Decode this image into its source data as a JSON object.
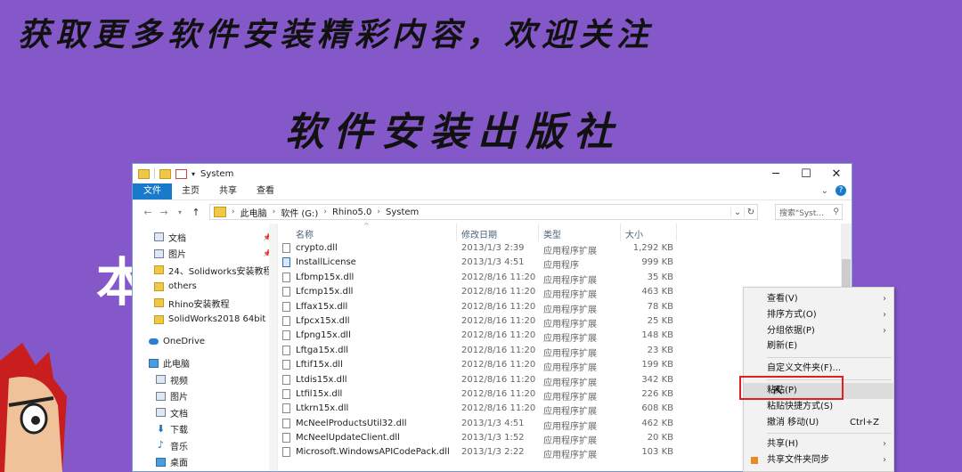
{
  "banner": {
    "top_text": "获取更多软件安装精彩内容，欢迎关注",
    "mid_text": "软件安装出版社",
    "left_char": "本"
  },
  "window": {
    "title": "System",
    "ctrl_min": "─",
    "ctrl_max": "☐",
    "ctrl_close": "✕",
    "tabs": [
      "文件",
      "主页",
      "共享",
      "查看"
    ],
    "address": {
      "crumbs": [
        "此电脑",
        "软件 (G:)",
        "Rhino5.0",
        "System"
      ],
      "search_placeholder": "搜索\"Syst..."
    }
  },
  "nav_pane": {
    "quick_access": [
      {
        "label": "文档",
        "icon": "doc-icon",
        "pinned": true
      },
      {
        "label": "图片",
        "icon": "picture-icon",
        "pinned": true
      },
      {
        "label": "24、Solidworks安装教程",
        "icon": "folder-icon",
        "pinned": false
      },
      {
        "label": "others",
        "icon": "folder-icon",
        "pinned": false
      },
      {
        "label": "Rhino安装教程",
        "icon": "folder-icon",
        "pinned": false
      },
      {
        "label": "SolidWorks2018 64bit",
        "icon": "folder-icon",
        "pinned": false
      }
    ],
    "onedrive": "OneDrive",
    "this_pc": "此电脑",
    "pc_items": [
      {
        "label": "视频",
        "icon": "video-icon"
      },
      {
        "label": "图片",
        "icon": "picture-icon"
      },
      {
        "label": "文档",
        "icon": "doc-icon"
      },
      {
        "label": "下载",
        "icon": "download-icon"
      },
      {
        "label": "音乐",
        "icon": "music-icon"
      },
      {
        "label": "桌面",
        "icon": "desktop-icon"
      }
    ]
  },
  "file_list": {
    "columns": {
      "name": "名称",
      "date": "修改日期",
      "type": "类型",
      "size": "大小"
    },
    "rows": [
      {
        "name": "crypto.dll",
        "date": "2013/1/3 2:39",
        "type": "应用程序扩展",
        "size": "1,292 KB",
        "kind": "dll"
      },
      {
        "name": "InstallLicense",
        "date": "2013/1/3 4:51",
        "type": "应用程序",
        "size": "999 KB",
        "kind": "app"
      },
      {
        "name": "Lfbmp15x.dll",
        "date": "2012/8/16 11:20",
        "type": "应用程序扩展",
        "size": "35 KB",
        "kind": "dll"
      },
      {
        "name": "Lfcmp15x.dll",
        "date": "2012/8/16 11:20",
        "type": "应用程序扩展",
        "size": "463 KB",
        "kind": "dll"
      },
      {
        "name": "Lffax15x.dll",
        "date": "2012/8/16 11:20",
        "type": "应用程序扩展",
        "size": "78 KB",
        "kind": "dll"
      },
      {
        "name": "Lfpcx15x.dll",
        "date": "2012/8/16 11:20",
        "type": "应用程序扩展",
        "size": "25 KB",
        "kind": "dll"
      },
      {
        "name": "Lfpng15x.dll",
        "date": "2012/8/16 11:20",
        "type": "应用程序扩展",
        "size": "148 KB",
        "kind": "dll"
      },
      {
        "name": "Lftga15x.dll",
        "date": "2012/8/16 11:20",
        "type": "应用程序扩展",
        "size": "23 KB",
        "kind": "dll"
      },
      {
        "name": "Lftif15x.dll",
        "date": "2012/8/16 11:20",
        "type": "应用程序扩展",
        "size": "199 KB",
        "kind": "dll"
      },
      {
        "name": "Ltdis15x.dll",
        "date": "2012/8/16 11:20",
        "type": "应用程序扩展",
        "size": "342 KB",
        "kind": "dll"
      },
      {
        "name": "Ltfil15x.dll",
        "date": "2012/8/16 11:20",
        "type": "应用程序扩展",
        "size": "226 KB",
        "kind": "dll"
      },
      {
        "name": "Ltkrn15x.dll",
        "date": "2012/8/16 11:20",
        "type": "应用程序扩展",
        "size": "608 KB",
        "kind": "dll"
      },
      {
        "name": "McNeelProductsUtil32.dll",
        "date": "2013/1/3 4:51",
        "type": "应用程序扩展",
        "size": "462 KB",
        "kind": "dll"
      },
      {
        "name": "McNeelUpdateClient.dll",
        "date": "2013/1/3 1:52",
        "type": "应用程序扩展",
        "size": "20 KB",
        "kind": "dll"
      },
      {
        "name": "Microsoft.WindowsAPICodePack.dll",
        "date": "2013/1/3 2:22",
        "type": "应用程序扩展",
        "size": "103 KB",
        "kind": "dll"
      }
    ]
  },
  "context_menu": {
    "items": [
      {
        "label": "查看(V)",
        "submenu": true
      },
      {
        "label": "排序方式(O)",
        "submenu": true
      },
      {
        "label": "分组依据(P)",
        "submenu": true
      },
      {
        "label": "刷新(E)",
        "submenu": false
      },
      {
        "sep": true
      },
      {
        "label": "自定义文件夹(F)...",
        "submenu": false
      },
      {
        "sep": true
      },
      {
        "label": "粘贴(P)",
        "submenu": false,
        "highlight": true
      },
      {
        "label": "粘贴快捷方式(S)",
        "submenu": false
      },
      {
        "label": "撤消 移动(U)",
        "submenu": false,
        "shortcut": "Ctrl+Z"
      },
      {
        "sep": true
      },
      {
        "label": "共享(H)",
        "submenu": true
      },
      {
        "label": "共享文件夹同步",
        "submenu": true,
        "icon": true
      }
    ]
  },
  "colors": {
    "background": "#8458c8",
    "accent": "#1979ca",
    "highlight_box": "#e02020"
  }
}
